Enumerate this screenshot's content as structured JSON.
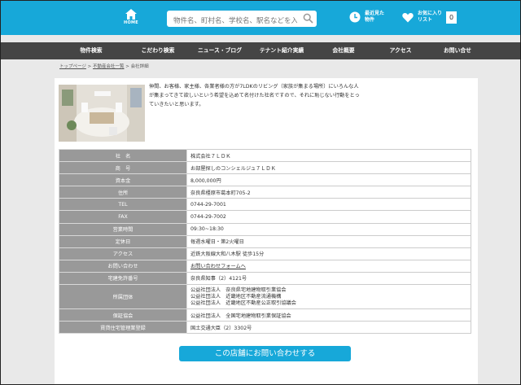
{
  "header": {
    "home_label": "HOME",
    "search_placeholder": "物件名、町村名、学校名、駅名などを入力",
    "history_line1": "最近見た",
    "history_line2": "物件",
    "favorites_line1": "お気に入り",
    "favorites_line2": "リスト",
    "favorites_count": "0"
  },
  "nav": {
    "items": [
      "物件検索",
      "こだわり検索",
      "ニュース・ブログ",
      "テナント紹介実績",
      "会社概要",
      "アクセス",
      "お問い合せ"
    ]
  },
  "breadcrumb": {
    "home": "トップページ",
    "sep": ">",
    "list": "不動産会社一覧",
    "current": "会社詳細"
  },
  "intro": "仲間、お客様、家主様、各業者様の方が7LDKのリビング（家族が集まる場所）にいろんな人が集まってきて欲しいという希望を込めて名付けた社名ですので、それに恥じない行動をとっていきたいと思います。",
  "company": {
    "rows": [
      {
        "label": "社　名",
        "value": "株式会社７ＬＤＫ"
      },
      {
        "label": "商　号",
        "value": "お部屋探しのコンシェルジュ７ＬＤＫ"
      },
      {
        "label": "資本金",
        "value": "8,000,000円"
      },
      {
        "label": "住所",
        "value": "奈良県橿原市葛本町705-2"
      },
      {
        "label": "TEL",
        "value": "0744-29-7001"
      },
      {
        "label": "FAX",
        "value": "0744-29-7002"
      },
      {
        "label": "営業時間",
        "value": "09:30~18:30"
      },
      {
        "label": "定休日",
        "value": "毎週水曜日・第2火曜日"
      },
      {
        "label": "アクセス",
        "value": "近鉄大阪線大和八木駅 徒歩15分"
      },
      {
        "label": "お問い合わせ",
        "value": "お問い合わせフォームへ"
      },
      {
        "label": "宅建免許番号",
        "value": "奈良県知事（2）4121号"
      }
    ],
    "groups_label": "所属団体",
    "groups": [
      "公益社団法人　奈良県宅地建物取引業協会",
      "公益社団法人　近畿地区不動産流通機構",
      "公益社団法人　近畿地区不動産公正取引協議会"
    ],
    "guarantee_label": "保証協会",
    "guarantee_value": "公益社団法人　全国宅地建物取引業保証協会",
    "rental_label": "賃貸住宅管理業登録",
    "rental_value": "国土交通大臣（2）3302号"
  },
  "cta_label": "この店舗にお問い合わせする",
  "colors": {
    "brand": "#17a8d9",
    "nav_bg": "#454545",
    "label_bg": "#999999"
  }
}
